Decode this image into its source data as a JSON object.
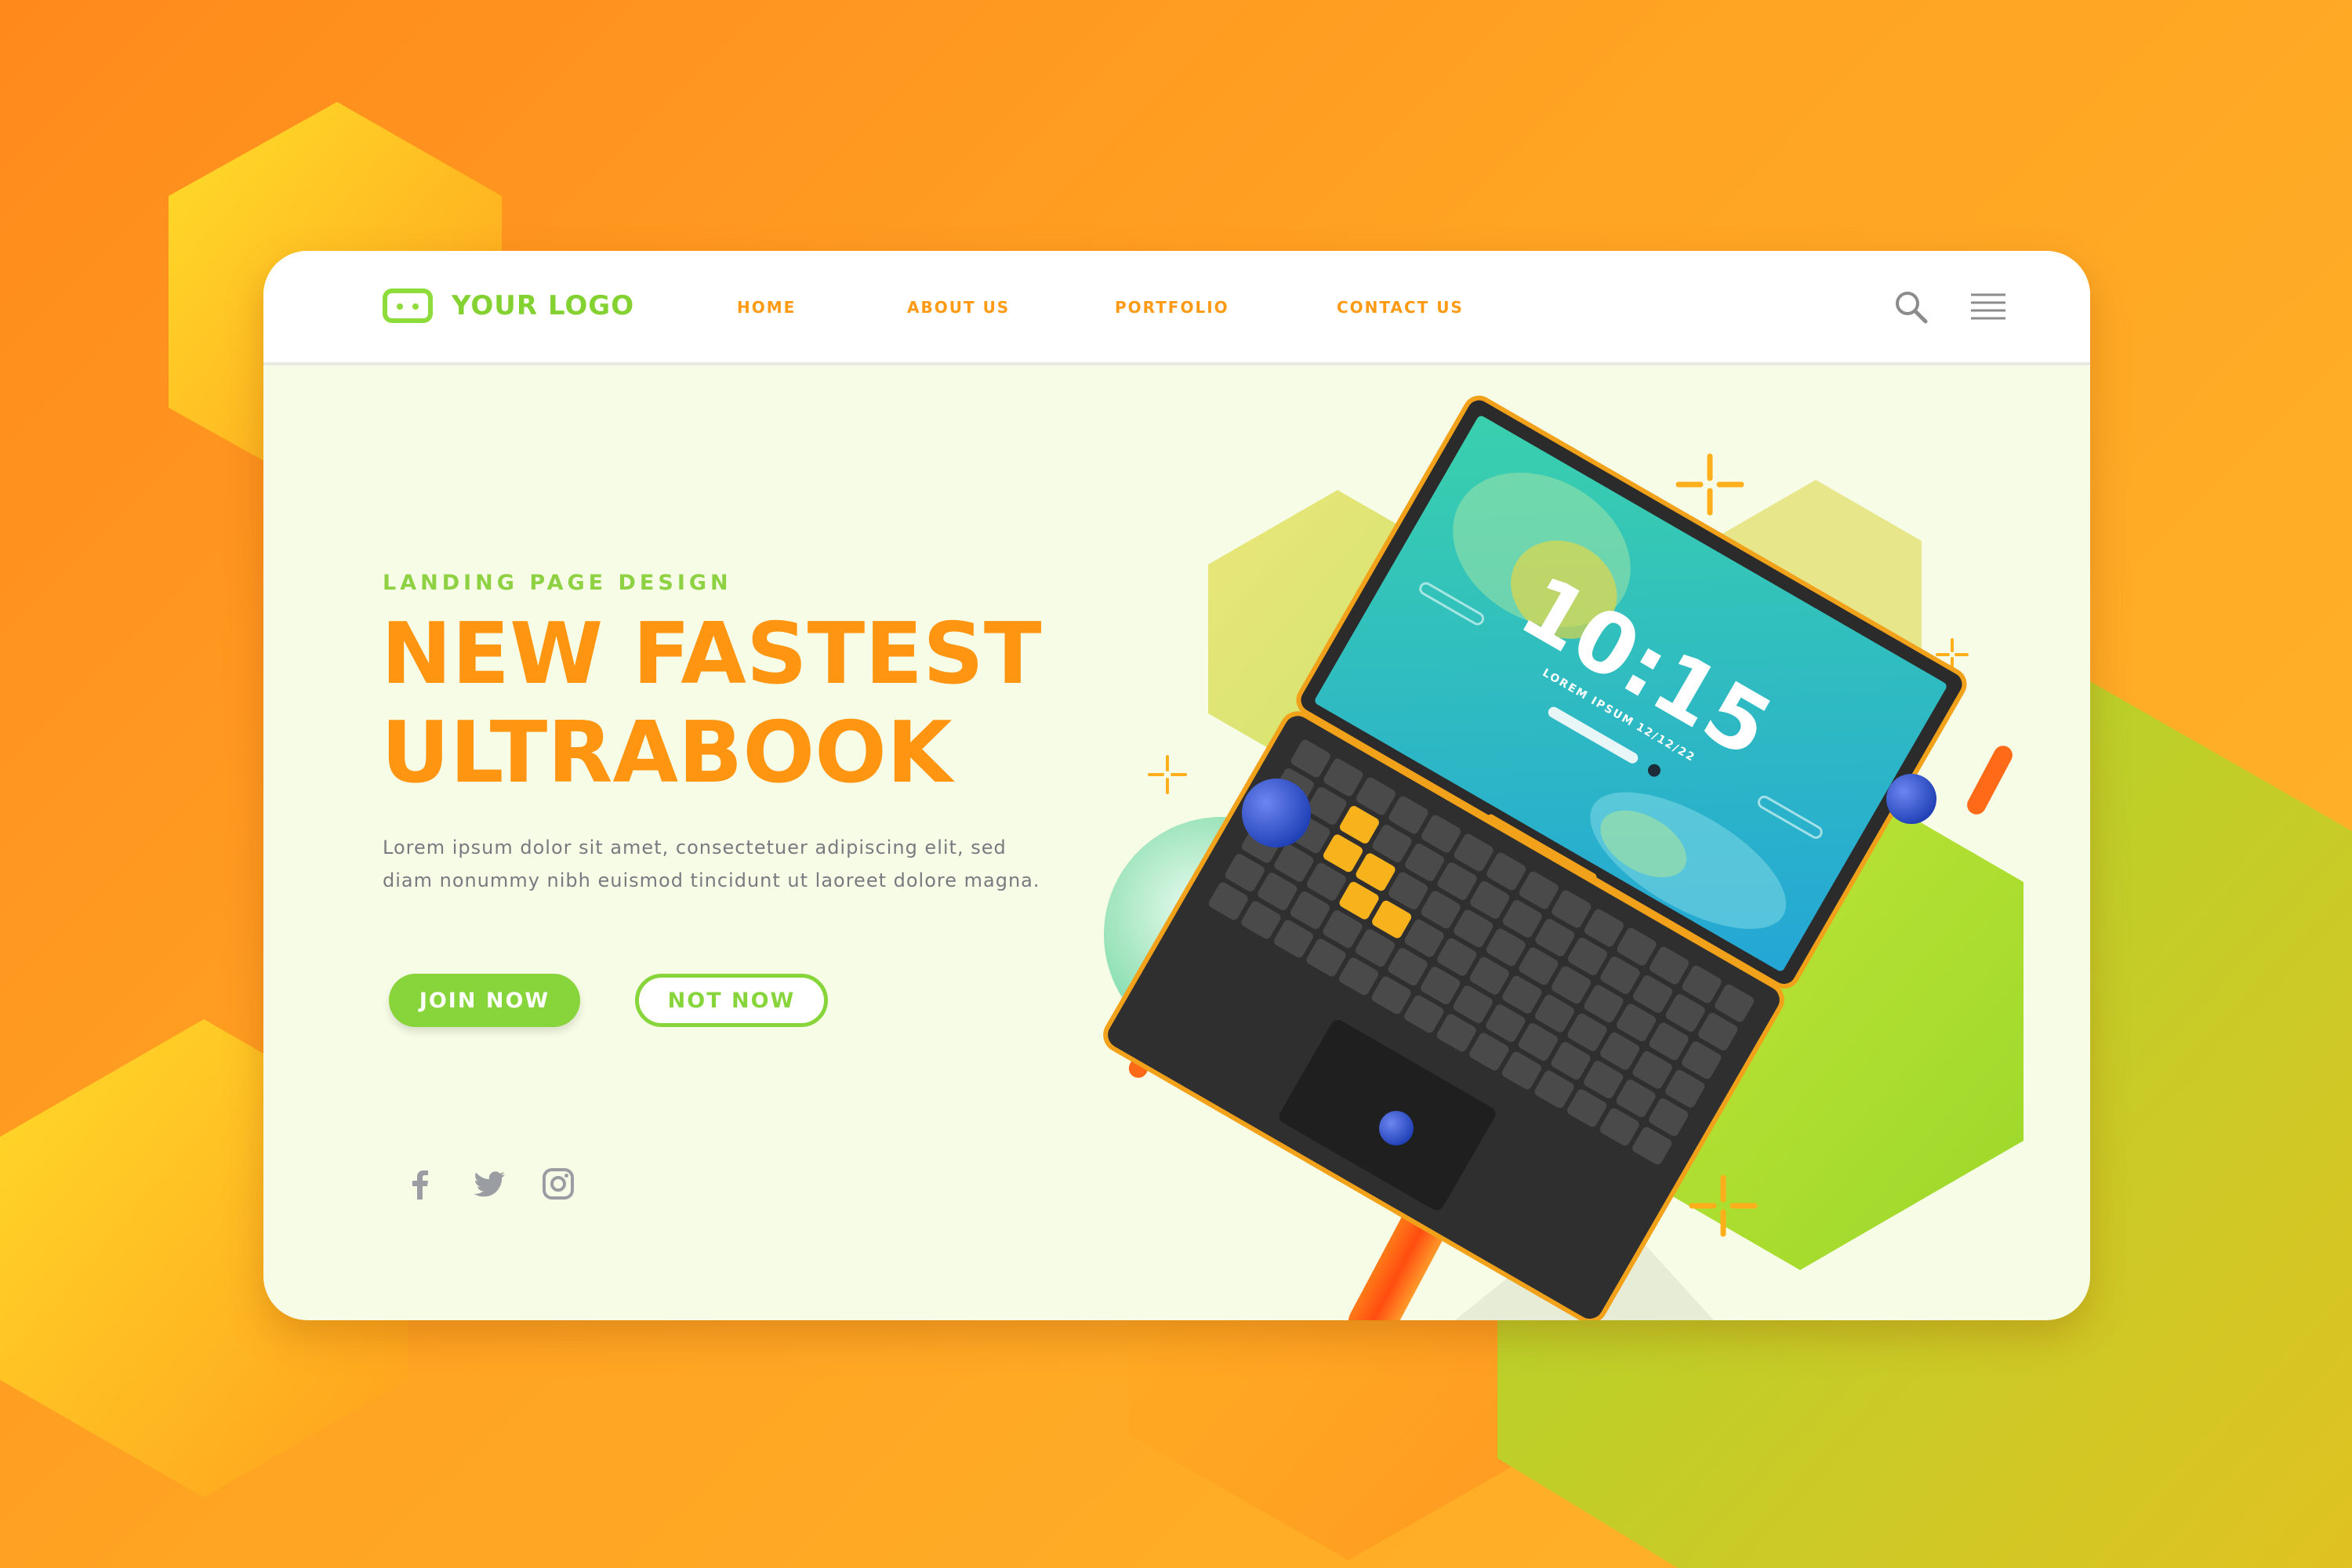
{
  "logo": {
    "text": "YOUR LOGO"
  },
  "nav": [
    {
      "label": "HOME"
    },
    {
      "label": "ABOUT US"
    },
    {
      "label": "PORTFOLIO"
    },
    {
      "label": "CONTACT US"
    }
  ],
  "icons": {
    "search": "search-icon",
    "menu": "hamburger-menu-icon",
    "social": [
      "facebook-icon",
      "twitter-icon",
      "instagram-icon"
    ]
  },
  "hero": {
    "kicker": "LANDING PAGE DESIGN",
    "title_line1": "NEW FASTEST",
    "title_line2": "ULTRABOOK",
    "desc_line1": "Lorem ipsum dolor sit amet, consectetuer adipiscing elit, sed",
    "desc_line2": "diam nonummy nibh euismod tincidunt ut laoreet dolore magna."
  },
  "buttons": {
    "join": "JOIN NOW",
    "not_now": "NOT NOW"
  },
  "laptop_screen": {
    "time": "10:15",
    "subtitle": "LOREM IPSUM",
    "date": "12/12/22"
  },
  "colors": {
    "primary_orange": "#ff9510",
    "accent_green": "#87d53a",
    "card_bg": "#f7fce6"
  }
}
